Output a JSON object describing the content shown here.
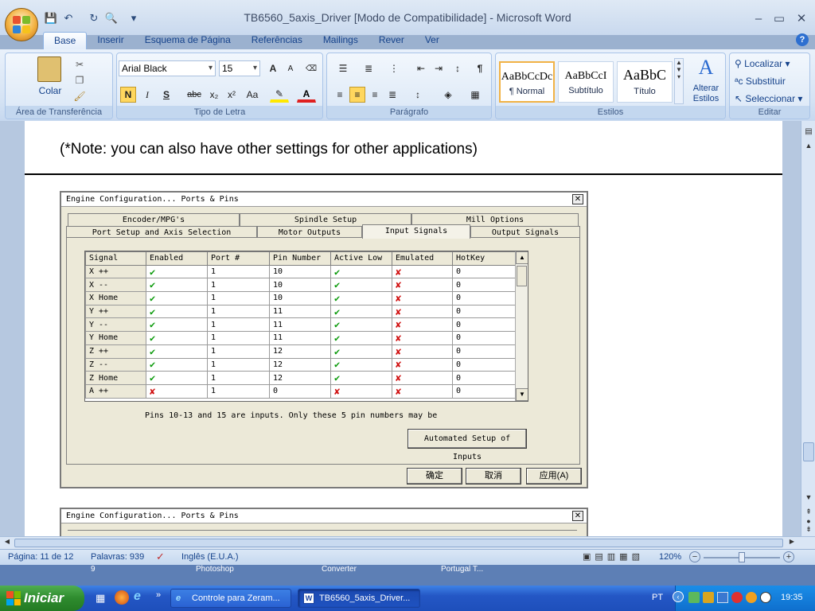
{
  "window": {
    "title": "TB6560_5axis_Driver [Modo de Compatibilidade] - Microsoft Word",
    "min": "–",
    "max": "▭",
    "close": "✕"
  },
  "quick_access": {
    "save": "💾",
    "undo": "↶",
    "redo": "↻",
    "preview": "🔍",
    "more": "▾"
  },
  "tabs": [
    "Base",
    "Inserir",
    "Esquema de Página",
    "Referências",
    "Mailings",
    "Rever",
    "Ver"
  ],
  "ribbon": {
    "clipboard": {
      "label": "Área de Transferência",
      "paste": "Colar"
    },
    "font": {
      "label": "Tipo de Letra",
      "family": "Arial Black",
      "size": "15",
      "bold": "N",
      "italic": "I",
      "underline": "S",
      "strike": "abc",
      "sub": "x₂",
      "sup": "x²",
      "case": "Aa",
      "grow": "A",
      "shrink": "A"
    },
    "paragraph": {
      "label": "Parágrafo"
    },
    "styles": {
      "label": "Estilos",
      "items": [
        {
          "sample": "AaBbCcDc",
          "name": "¶ Normal"
        },
        {
          "sample": "AaBbCcI",
          "name": "Subtítulo"
        },
        {
          "sample": "AaBbC",
          "name": "Título"
        }
      ],
      "change": "Alterar Estilos"
    },
    "editing": {
      "label": "Editar",
      "find": "Localizar",
      "replace": "Substituir",
      "select": "Seleccionar"
    }
  },
  "document": {
    "note": "(*Note: you can also have other settings for other applications)"
  },
  "dialog": {
    "title": "Engine Configuration... Ports & Pins",
    "tabs_row1": [
      "Encoder/MPG's",
      "Spindle Setup",
      "Mill Options"
    ],
    "tabs_row2": [
      "Port Setup and Axis Selection",
      "Motor Outputs",
      "Input Signals",
      "Output Signals"
    ],
    "columns": [
      "Signal",
      "Enabled",
      "Port #",
      "Pin Number",
      "Active Low",
      "Emulated",
      "HotKey"
    ],
    "rows": [
      {
        "signal": "X ++",
        "enabled": true,
        "port": "1",
        "pin": "10",
        "active_low": true,
        "emulated": false,
        "hotkey": "0"
      },
      {
        "signal": "X --",
        "enabled": true,
        "port": "1",
        "pin": "10",
        "active_low": true,
        "emulated": false,
        "hotkey": "0"
      },
      {
        "signal": "X Home",
        "enabled": true,
        "port": "1",
        "pin": "10",
        "active_low": true,
        "emulated": false,
        "hotkey": "0"
      },
      {
        "signal": "Y ++",
        "enabled": true,
        "port": "1",
        "pin": "11",
        "active_low": true,
        "emulated": false,
        "hotkey": "0"
      },
      {
        "signal": "Y --",
        "enabled": true,
        "port": "1",
        "pin": "11",
        "active_low": true,
        "emulated": false,
        "hotkey": "0"
      },
      {
        "signal": "Y Home",
        "enabled": true,
        "port": "1",
        "pin": "11",
        "active_low": true,
        "emulated": false,
        "hotkey": "0"
      },
      {
        "signal": "Z ++",
        "enabled": true,
        "port": "1",
        "pin": "12",
        "active_low": true,
        "emulated": false,
        "hotkey": "0"
      },
      {
        "signal": "Z --",
        "enabled": true,
        "port": "1",
        "pin": "12",
        "active_low": true,
        "emulated": false,
        "hotkey": "0"
      },
      {
        "signal": "Z Home",
        "enabled": true,
        "port": "1",
        "pin": "12",
        "active_low": true,
        "emulated": false,
        "hotkey": "0"
      },
      {
        "signal": "A ++",
        "enabled": false,
        "port": "1",
        "pin": "0",
        "active_low": false,
        "emulated": false,
        "hotkey": "0"
      }
    ],
    "hint": "Pins 10-13 and 15 are inputs. Only these 5 pin numbers may be",
    "auto_setup": "Automated Setup of Inputs",
    "ok": "确定",
    "cancel": "取消",
    "apply": "应用(A)"
  },
  "dialog2": {
    "title": "Engine Configuration... Ports & Pins"
  },
  "status": {
    "page": "Página: 11 de 12",
    "words": "Palavras: 939",
    "lang": "Inglês (E.U.A.)",
    "zoom": "120%"
  },
  "desktop_icons": [
    "9",
    "Photoshop",
    "Converter",
    "Portugal T..."
  ],
  "taskbar": {
    "start": "Iniciar",
    "items": [
      "Controle para Zeram...",
      "TB6560_5axis_Driver..."
    ],
    "lang": "PT",
    "time": "19:35"
  },
  "colors": {
    "check": "#0a9a0a",
    "cross": "#d01010",
    "ribbon": "#d5e3f4"
  }
}
